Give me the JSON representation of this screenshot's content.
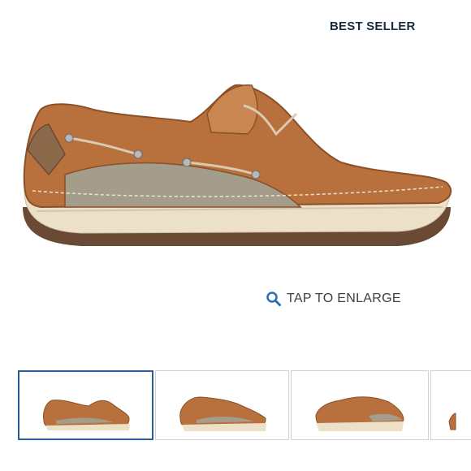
{
  "badge": {
    "label": "BEST SELLER"
  },
  "enlarge": {
    "label": "TAP TO ENLARGE",
    "icon": "magnifier-icon"
  },
  "thumbnails": {
    "selected_index": 0,
    "count_visible": 4
  },
  "colors": {
    "leather": "#b8703d",
    "leather_dark": "#8a5028",
    "mesh": "#a59d8c",
    "sole": "#e9dcc4",
    "outsole": "#6b4a35",
    "selected_border": "#2a5d9a",
    "icon_blue": "#2a6fb5",
    "badge_text": "#1c2a3f"
  }
}
